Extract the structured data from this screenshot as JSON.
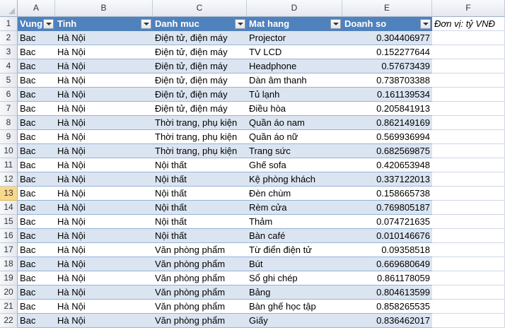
{
  "columns": [
    "A",
    "B",
    "C",
    "D",
    "E",
    "F"
  ],
  "headers": [
    "Vung",
    "Tinh",
    "Danh muc",
    "Mat hang",
    "Doanh so"
  ],
  "note": "Đơn vị: tỷ VNĐ",
  "rows": [
    {
      "num": "1"
    },
    {
      "num": "2",
      "vung": "Bac",
      "tinh": "Hà Nội",
      "danh_muc": "Điện tử, điện máy",
      "mat_hang": "Projector",
      "doanh_so": "0.304406977"
    },
    {
      "num": "3",
      "vung": "Bac",
      "tinh": "Hà Nội",
      "danh_muc": "Điện tử, điện máy",
      "mat_hang": "TV LCD",
      "doanh_so": "0.152277644"
    },
    {
      "num": "4",
      "vung": "Bac",
      "tinh": "Hà Nội",
      "danh_muc": "Điện tử, điện máy",
      "mat_hang": "Headphone",
      "doanh_so": "0.57673439"
    },
    {
      "num": "5",
      "vung": "Bac",
      "tinh": "Hà Nội",
      "danh_muc": "Điện tử, điện máy",
      "mat_hang": "Dàn âm thanh",
      "doanh_so": "0.738703388"
    },
    {
      "num": "6",
      "vung": "Bac",
      "tinh": "Hà Nội",
      "danh_muc": "Điện tử, điện máy",
      "mat_hang": "Tủ lạnh",
      "doanh_so": "0.161139534"
    },
    {
      "num": "7",
      "vung": "Bac",
      "tinh": "Hà Nội",
      "danh_muc": "Điện tử, điện máy",
      "mat_hang": "Điều hòa",
      "doanh_so": "0.205841913"
    },
    {
      "num": "8",
      "vung": "Bac",
      "tinh": "Hà Nội",
      "danh_muc": "Thời trang, phụ kiện",
      "mat_hang": "Quần áo nam",
      "doanh_so": "0.862149169"
    },
    {
      "num": "9",
      "vung": "Bac",
      "tinh": "Hà Nội",
      "danh_muc": "Thời trang, phụ kiện",
      "mat_hang": "Quần áo nữ",
      "doanh_so": "0.569936994"
    },
    {
      "num": "10",
      "vung": "Bac",
      "tinh": "Hà Nội",
      "danh_muc": "Thời trang, phụ kiện",
      "mat_hang": "Trang sức",
      "doanh_so": "0.682569875"
    },
    {
      "num": "11",
      "vung": "Bac",
      "tinh": "Hà Nội",
      "danh_muc": "Nội thất",
      "mat_hang": "Ghế sofa",
      "doanh_so": "0.420653948"
    },
    {
      "num": "12",
      "vung": "Bac",
      "tinh": "Hà Nội",
      "danh_muc": "Nội thất",
      "mat_hang": "Kệ phòng khách",
      "doanh_so": "0.337122013"
    },
    {
      "num": "13",
      "vung": "Bac",
      "tinh": "Hà Nội",
      "danh_muc": "Nội thất",
      "mat_hang": "Đèn chùm",
      "doanh_so": "0.158665738"
    },
    {
      "num": "14",
      "vung": "Bac",
      "tinh": "Hà Nội",
      "danh_muc": "Nội thất",
      "mat_hang": "Rèm cửa",
      "doanh_so": "0.769805187"
    },
    {
      "num": "15",
      "vung": "Bac",
      "tinh": "Hà Nội",
      "danh_muc": "Nội thất",
      "mat_hang": "Thảm",
      "doanh_so": "0.074721635"
    },
    {
      "num": "16",
      "vung": "Bac",
      "tinh": "Hà Nội",
      "danh_muc": "Nội thất",
      "mat_hang": "Bàn café",
      "doanh_so": "0.010146676"
    },
    {
      "num": "17",
      "vung": "Bac",
      "tinh": "Hà Nội",
      "danh_muc": "Văn phòng phẩm",
      "mat_hang": "Từ điển điện tử",
      "doanh_so": "0.09358518"
    },
    {
      "num": "18",
      "vung": "Bac",
      "tinh": "Hà Nội",
      "danh_muc": "Văn phòng phẩm",
      "mat_hang": "Bút",
      "doanh_so": "0.669680649"
    },
    {
      "num": "19",
      "vung": "Bac",
      "tinh": "Hà Nội",
      "danh_muc": "Văn phòng phẩm",
      "mat_hang": "Sổ ghi chép",
      "doanh_so": "0.861178059"
    },
    {
      "num": "20",
      "vung": "Bac",
      "tinh": "Hà Nội",
      "danh_muc": "Văn phòng phẩm",
      "mat_hang": "Bảng",
      "doanh_so": "0.804613599"
    },
    {
      "num": "21",
      "vung": "Bac",
      "tinh": "Hà Nội",
      "danh_muc": "Văn phòng phẩm",
      "mat_hang": "Bàn ghế học tập",
      "doanh_so": "0.858265535"
    },
    {
      "num": "22",
      "vung": "Bac",
      "tinh": "Hà Nội",
      "danh_muc": "Văn phòng phẩm",
      "mat_hang": "Giấy",
      "doanh_so": "0.836462017"
    }
  ]
}
